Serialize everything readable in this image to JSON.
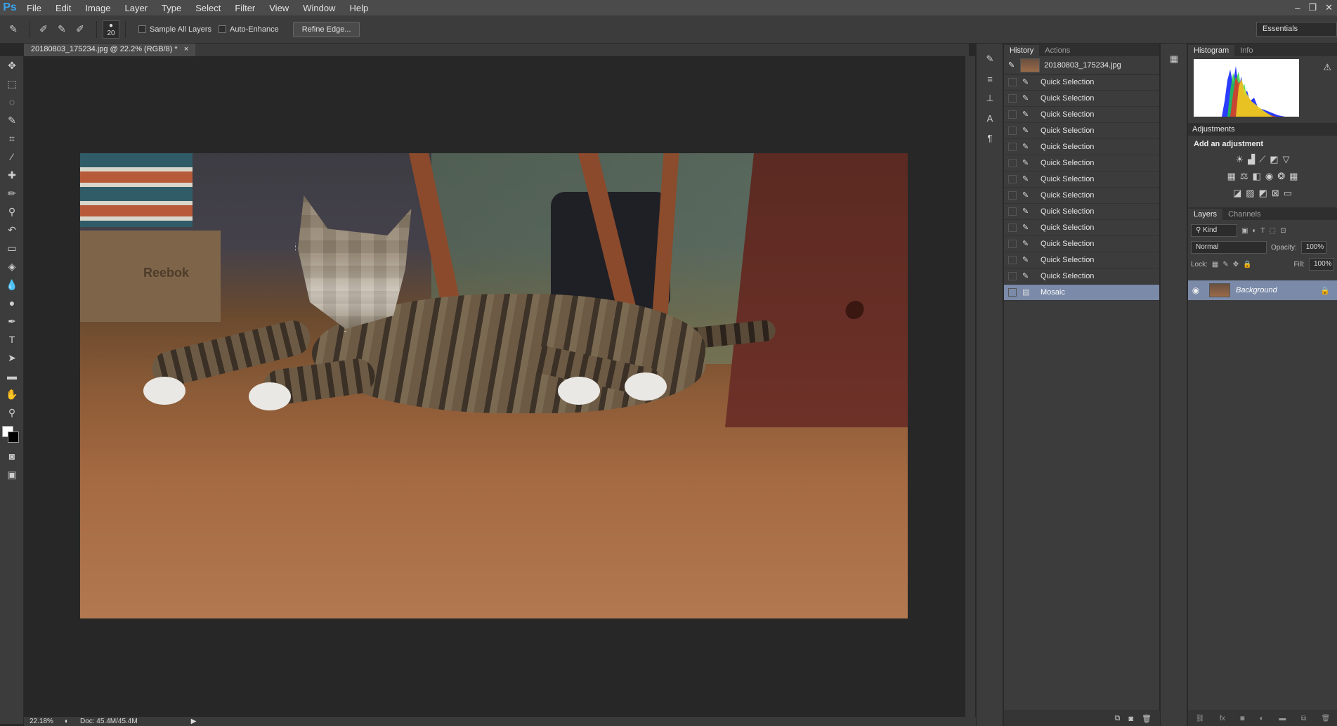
{
  "app": {
    "logo": "Ps"
  },
  "menu": [
    "File",
    "Edit",
    "Image",
    "Layer",
    "Type",
    "Select",
    "Filter",
    "View",
    "Window",
    "Help"
  ],
  "window_controls": [
    "–",
    "❐",
    "✕"
  ],
  "options": {
    "brush_size": "20",
    "sample_all_layers": "Sample All Layers",
    "auto_enhance": "Auto-Enhance",
    "refine_edge": "Refine Edge...",
    "workspace": "Essentials"
  },
  "document": {
    "tab_title": "20180803_175234.jpg @ 22.2% (RGB/8) *",
    "photo_text": "Reebok"
  },
  "history": {
    "tabs": [
      "History",
      "Actions"
    ],
    "snapshot_name": "20180803_175234.jpg",
    "items": [
      "Quick Selection",
      "Quick Selection",
      "Quick Selection",
      "Quick Selection",
      "Quick Selection",
      "Quick Selection",
      "Quick Selection",
      "Quick Selection",
      "Quick Selection",
      "Quick Selection",
      "Quick Selection",
      "Quick Selection",
      "Quick Selection"
    ],
    "selected_item": "Mosaic"
  },
  "histogram_panel": {
    "tabs": [
      "Histogram",
      "Info"
    ],
    "warning": "⚠"
  },
  "adjustments": {
    "title": "Adjustments",
    "subtitle": "Add an adjustment"
  },
  "layers": {
    "tabs": [
      "Layers",
      "Channels"
    ],
    "filter": "Kind",
    "blend_mode": "Normal",
    "opacity_label": "Opacity:",
    "opacity_value": "100%",
    "lock_label": "Lock:",
    "fill_label": "Fill:",
    "fill_value": "100%",
    "layer_name": "Background"
  },
  "status": {
    "zoom": "22.18%",
    "doc_size": "Doc: 45.4M/45.4M"
  },
  "colors": {
    "foreground": "#ffffff",
    "background": "#000000",
    "selection_highlight": "#7a8aa8"
  }
}
